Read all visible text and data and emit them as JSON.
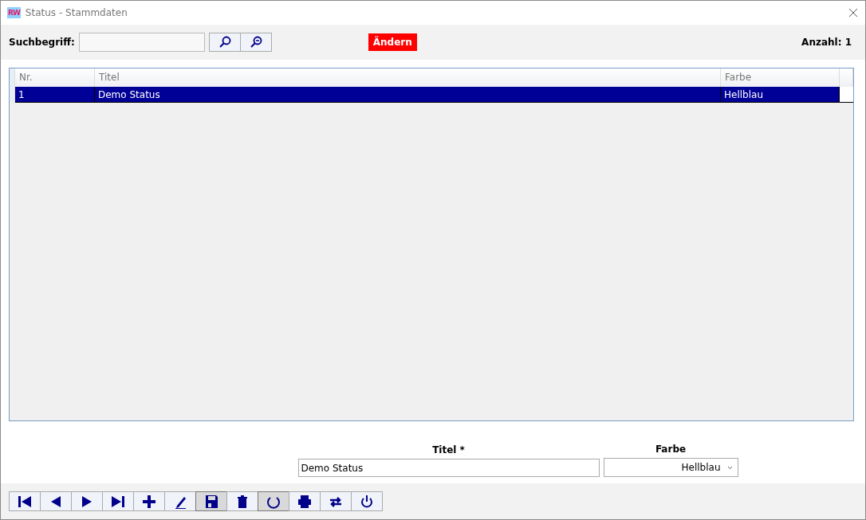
{
  "window": {
    "title": "Status - Stammdaten",
    "logo": "RW"
  },
  "search": {
    "label": "Suchbegriff:"
  },
  "change_badge": "Ändern",
  "count": "Anzahl: 1",
  "table": {
    "columns": [
      "Nr.",
      "Titel",
      "Farbe"
    ],
    "rows": [
      {
        "cells": [
          "1",
          "Demo Status",
          "Hellblau"
        ],
        "selected": true
      }
    ]
  },
  "form": {
    "fields": [
      {
        "label": "Titel *",
        "kind": "text",
        "value": "Demo Status"
      },
      {
        "label": "Farbe",
        "kind": "select",
        "value": "Hellblau"
      }
    ]
  },
  "toolbar": [
    {
      "active": false
    },
    {
      "active": false
    },
    {
      "active": false
    },
    {
      "active": false
    },
    {
      "active": false
    },
    {
      "active": false
    },
    {
      "active": true
    },
    {
      "active": false
    },
    {
      "active": true
    },
    {
      "active": false
    },
    {
      "active": false
    },
    {
      "active": false
    }
  ]
}
